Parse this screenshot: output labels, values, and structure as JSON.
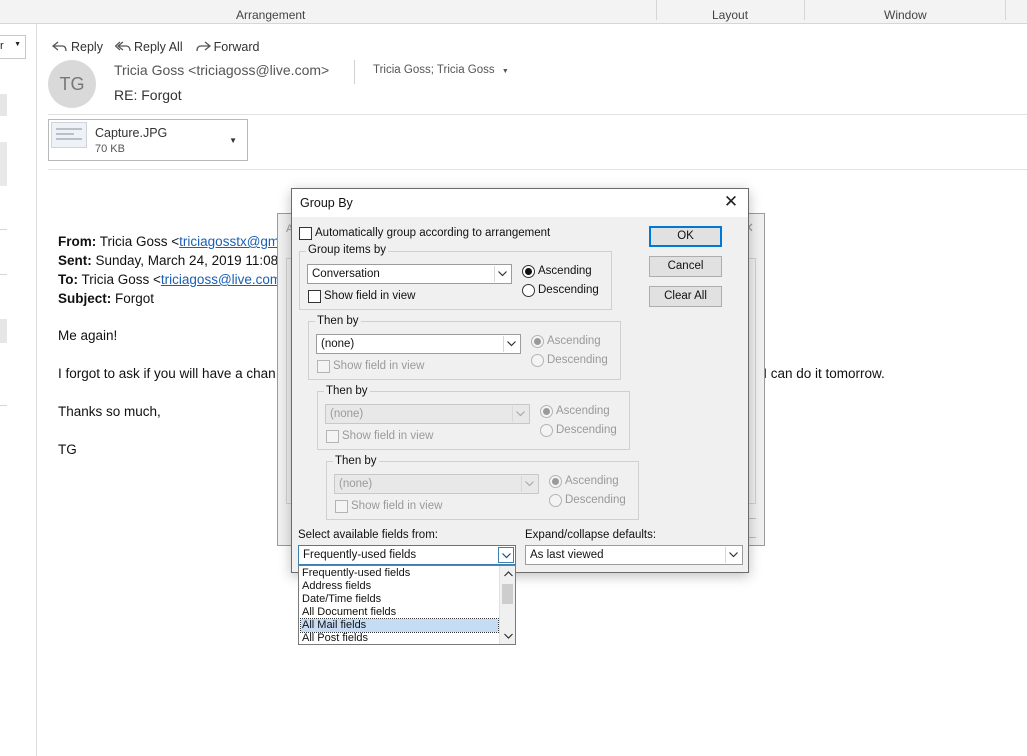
{
  "ribbon": {
    "groups": [
      "Arrangement",
      "Layout",
      "Window"
    ]
  },
  "left_pane": {
    "dropdown_text": "r"
  },
  "message": {
    "actions": [
      "Reply",
      "Reply All",
      "Forward"
    ],
    "avatar_initials": "TG",
    "sender": "Tricia Goss <triciagoss@live.com>",
    "recipients": "Tricia Goss; Tricia Goss",
    "subject": "RE: Forgot",
    "attachment": {
      "name": "Capture.JPG",
      "size": "70 KB"
    },
    "body": {
      "from_label": "From:",
      "from_value": "Tricia Goss <",
      "from_link": "triciagosstx@gma",
      "sent_label": "Sent:",
      "sent_value": "Sunday, March 24, 2019 11:08",
      "to_label": "To:",
      "to_value": "Tricia Goss <",
      "to_link": "triciagoss@live.com",
      "subject_label": "Subject:",
      "subject_value": "Forgot",
      "line1": "Me again!",
      "line2_start": "I forgot to ask if you will have a chan",
      "line2_end": "t, I can do it tomorrow.",
      "line3": "Thanks so much,",
      "line4": "TG"
    }
  },
  "dialog": {
    "title": "Group By",
    "auto_group_label": "Automatically group according to arrangement",
    "group_items_by": {
      "title": "Group items by",
      "field": "Conversation",
      "show_field": "Show field in view",
      "ascending": "Ascending",
      "descending": "Descending"
    },
    "then_by_1": {
      "title": "Then by",
      "field": "(none)",
      "show_field": "Show field in view",
      "ascending": "Ascending",
      "descending": "Descending"
    },
    "then_by_2": {
      "title": "Then by",
      "field": "(none)",
      "show_field": "Show field in view",
      "ascending": "Ascending",
      "descending": "Descending"
    },
    "then_by_3": {
      "title": "Then by",
      "field": "(none)",
      "show_field": "Show field in view",
      "ascending": "Ascending",
      "descending": "Descending"
    },
    "select_fields_label": "Select available fields from:",
    "select_fields_value": "Frequently-used fields",
    "expand_label": "Expand/collapse defaults:",
    "expand_value": "As last viewed",
    "buttons": {
      "ok": "OK",
      "cancel": "Cancel",
      "clear_all": "Clear All"
    },
    "field_options": [
      "Frequently-used fields",
      "Address fields",
      "Date/Time fields",
      "All Document fields",
      "All Mail fields",
      "All Post fields"
    ],
    "highlighted_option": "All Mail fields"
  },
  "background_dialog": {
    "title_fragment": "A",
    "close_glyph": "✕"
  }
}
